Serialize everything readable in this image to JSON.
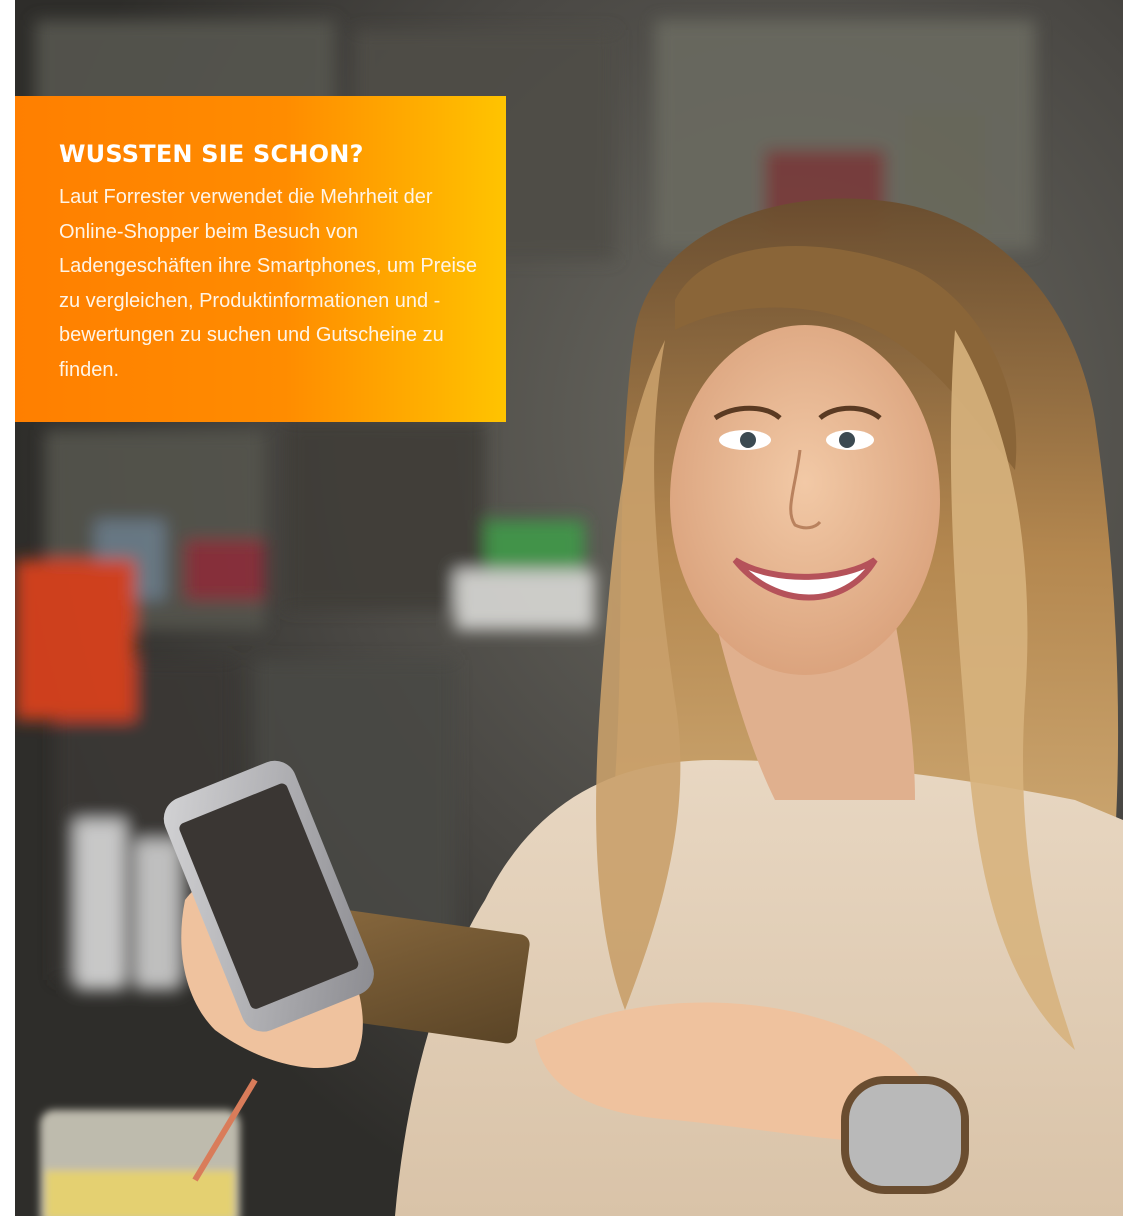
{
  "callout": {
    "title": "WUSSTEN SIE SCHON?",
    "body": "Laut Forrester verwendet die Mehrheit der Online-Shopper beim Besuch von Ladengeschäften ihre Smartphones, um Preise zu vergleichen, Produktinformationen und -bewertungen zu suchen und Gutscheine zu finden."
  },
  "colors": {
    "callout_start": "#ff7f00",
    "callout_end": "#ffc400",
    "text": "#ffffff"
  },
  "photo": {
    "subject": "woman-smiling-holding-smartphone-and-credit-card-icon"
  }
}
